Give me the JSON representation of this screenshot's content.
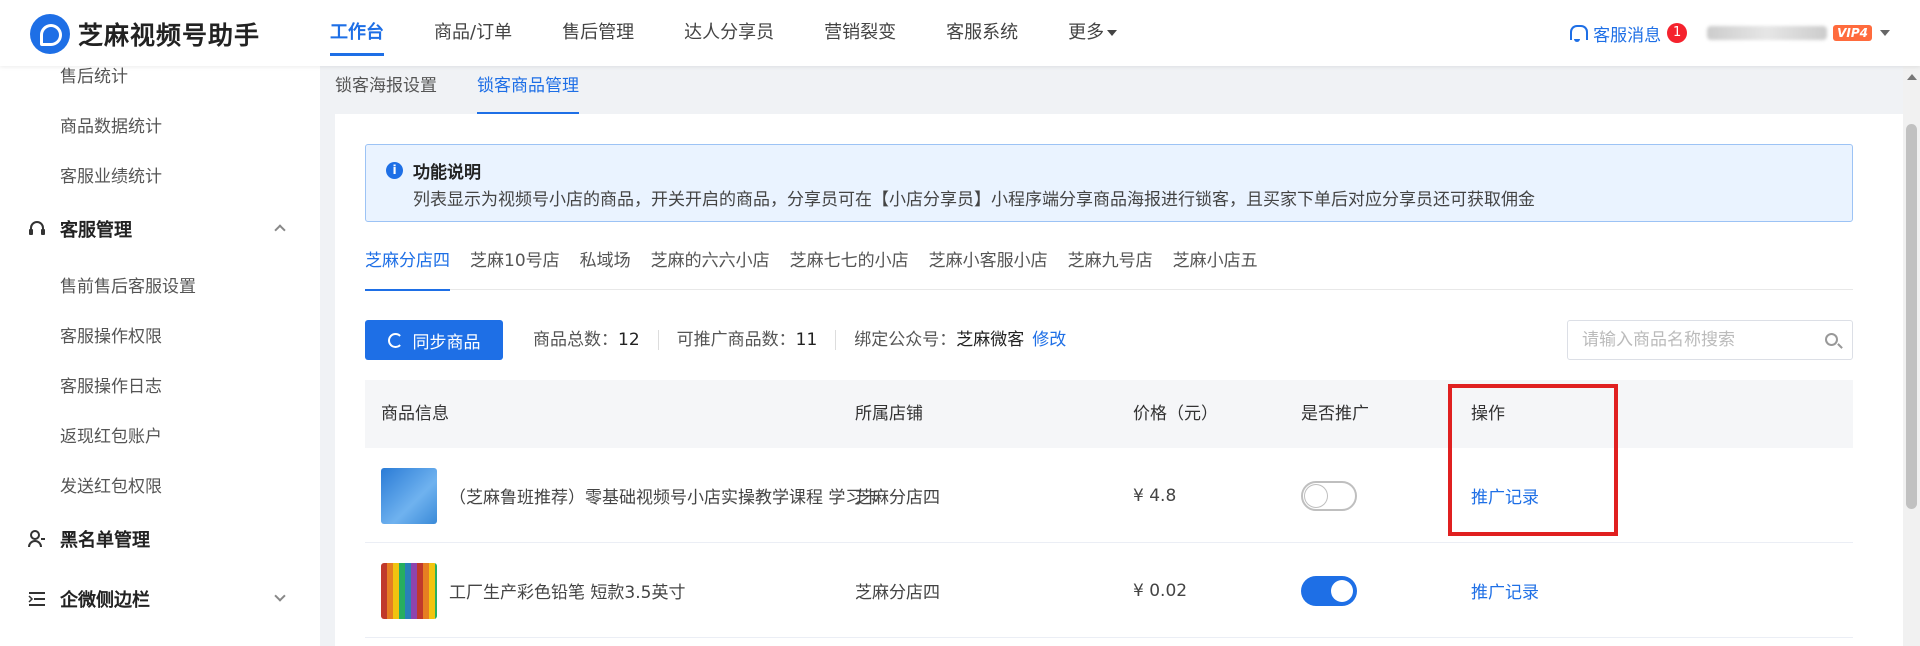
{
  "app": {
    "title": "芝麻视频号助手"
  },
  "nav": {
    "items": [
      "工作台",
      "商品/订单",
      "售后管理",
      "达人分享员",
      "营销裂变",
      "客服系统",
      "更多"
    ],
    "active_index": 0
  },
  "topbar": {
    "message_label": "客服消息",
    "message_count": "1",
    "vip_label": "VIP4"
  },
  "sidebar": {
    "items_top": [
      "售后统计",
      "商品数据统计",
      "客服业绩统计"
    ],
    "group_service": "客服管理",
    "items_service": [
      "售前售后客服设置",
      "客服操作权限",
      "客服操作日志",
      "返现红包账户",
      "发送红包权限"
    ],
    "group_blacklist": "黑名单管理",
    "group_wecom": "企微侧边栏"
  },
  "subtabs": [
    "锁客海报设置",
    "锁客商品管理"
  ],
  "notice": {
    "title": "功能说明",
    "text": "列表显示为视频号小店的商品，开关开启的商品，分享员可在【小店分享员】小程序端分享商品海报进行锁客，且买家下单后对应分享员还可获取佣金"
  },
  "shop_tabs": [
    "芝麻分店四",
    "芝麻10号店",
    "私域场",
    "芝麻的六六小店",
    "芝麻七七的小店",
    "芝麻小客服小店",
    "芝麻九号店",
    "芝麻小店五"
  ],
  "toolbar": {
    "sync_label": "同步商品",
    "total_label": "商品总数：",
    "total_value": "12",
    "promotable_label": "可推广商品数：",
    "promotable_value": "11",
    "account_label": "绑定公众号：",
    "account_value": "芝麻微客",
    "edit_label": "修改",
    "search_placeholder": "请输入商品名称搜索"
  },
  "table": {
    "headers": [
      "商品信息",
      "所属店铺",
      "价格（元）",
      "是否推广",
      "操作"
    ],
    "rows": [
      {
        "name": "（芝麻鲁班推荐）零基础视频号小店实操教学课程 学习卡",
        "shop": "芝麻分店四",
        "price": "¥ 4.8",
        "promoted": false,
        "action": "推广记录"
      },
      {
        "name": "工厂生产彩色铅笔 短款3.5英寸",
        "shop": "芝麻分店四",
        "price": "¥ 0.02",
        "promoted": true,
        "action": "推广记录"
      }
    ]
  },
  "colors": {
    "accent": "#1e6fe6",
    "highlight": "#e02020",
    "notice_bg": "#eaf3ff"
  }
}
